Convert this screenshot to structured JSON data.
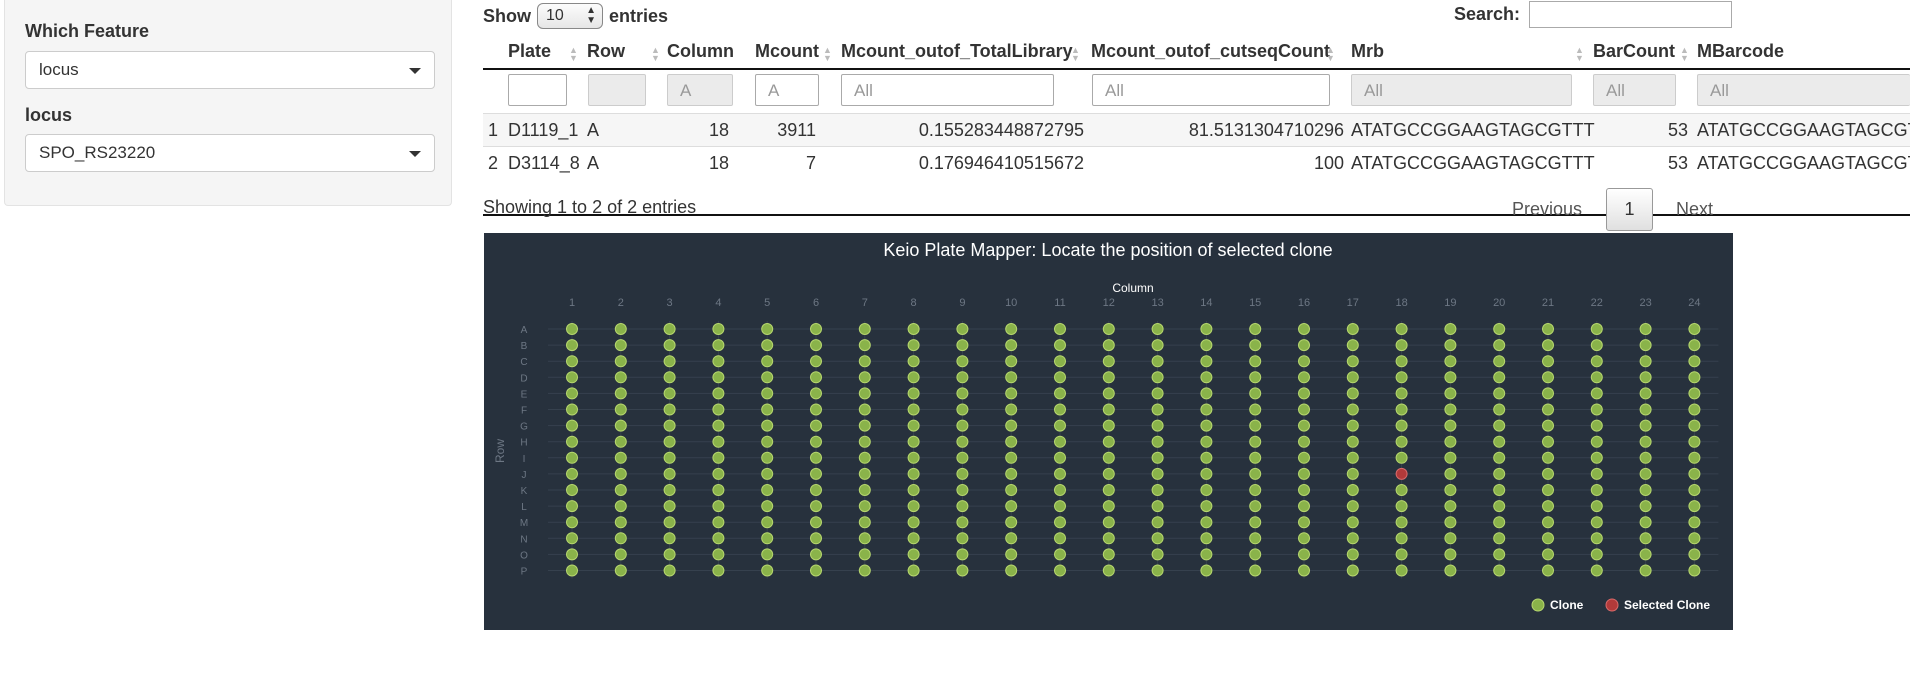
{
  "sidebar": {
    "feature_label": "Which Feature",
    "feature_value": "locus",
    "locus_label": "locus",
    "locus_value": "SPO_RS23220"
  },
  "table_controls": {
    "show_label": "Show",
    "page_length": "10",
    "entries_label": "entries",
    "search_label": "Search:",
    "search_value": ""
  },
  "table": {
    "columns": [
      "Plate",
      "Row",
      "Column",
      "Mcount",
      "Mcount_outof_TotalLibrary",
      "Mcount_outof_cutseqCount",
      "Mrb",
      "BarCount",
      "MBarcode"
    ],
    "filters": [
      "",
      "",
      "A",
      "A",
      "All",
      "All",
      "All",
      "All",
      "All"
    ],
    "rows": [
      [
        "1",
        "D1119_1",
        "A",
        "18",
        "3911",
        "0.155283448872795",
        "81.5131304710296",
        "ATATGCCGGAAGTAGCGTTT",
        "53",
        "ATATGCCGGAAGTAGCGT"
      ],
      [
        "2",
        "D3114_8",
        "A",
        "18",
        "7",
        "0.176946410515672",
        "100",
        "ATATGCCGGAAGTAGCGTTT",
        "53",
        "ATATGCCGGAAGTAGCGT"
      ]
    ],
    "info": "Showing 1 to 2 of 2 entries",
    "prev_label": "Previous",
    "current_page": "1",
    "next_label": "Next"
  },
  "chart_data": {
    "type": "scatter",
    "title": "Keio Plate Mapper: Locate the position of selected clone",
    "xlabel": "Column",
    "ylabel": "Row",
    "x_categories": [
      "1",
      "2",
      "3",
      "4",
      "5",
      "6",
      "7",
      "8",
      "9",
      "10",
      "11",
      "12",
      "13",
      "14",
      "15",
      "16",
      "17",
      "18",
      "19",
      "20",
      "21",
      "22",
      "23",
      "24"
    ],
    "y_categories": [
      "A",
      "B",
      "C",
      "D",
      "E",
      "F",
      "G",
      "H",
      "I",
      "J",
      "K",
      "L",
      "M",
      "N",
      "O",
      "P"
    ],
    "series": [
      {
        "name": "Clone",
        "color": "#8ab34a",
        "points": "all wells A1-P24"
      },
      {
        "name": "Selected Clone",
        "color": "#b23a3a",
        "points": [
          {
            "column": "18",
            "row": "J"
          }
        ]
      }
    ],
    "legend_position": "bottom-right",
    "grid": true,
    "colors": {
      "background": "#27313d",
      "clone": "#8ab34a",
      "selected": "#b23a3a",
      "text": "#ffffff",
      "tick": "#6d7784"
    }
  }
}
